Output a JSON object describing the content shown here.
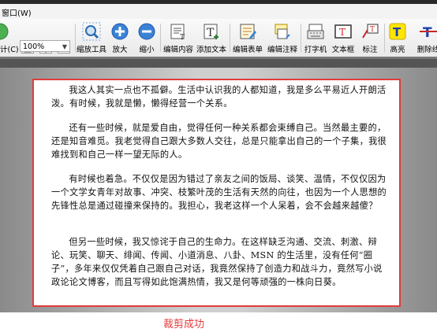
{
  "menu": {
    "window": "窗口(W)"
  },
  "toolbar": {
    "zoom_value": "100%",
    "left_partial": "计(C)",
    "items": [
      {
        "name": "zoom-tool",
        "label": "缩放工具"
      },
      {
        "name": "zoom-in",
        "label": "放大"
      },
      {
        "name": "zoom-out",
        "label": "缩小"
      },
      {
        "name": "edit-content",
        "label": "编辑内容"
      },
      {
        "name": "add-text",
        "label": "添加文本"
      },
      {
        "name": "edit-form",
        "label": "编辑表单"
      },
      {
        "name": "edit-annotation",
        "label": "编辑注释"
      },
      {
        "name": "typewriter",
        "label": "打字机"
      },
      {
        "name": "textbox",
        "label": "文本框"
      },
      {
        "name": "callout",
        "label": "标注"
      },
      {
        "name": "highlight",
        "label": "高亮"
      },
      {
        "name": "strikethrough",
        "label": "删除线"
      }
    ]
  },
  "document": {
    "paragraphs": [
      "我这人其实一点也不孤僻。生活中认识我的人都知道，我是多么平易近人开朗活泼。有时候，我就是懒，懒得经营一个关系。",
      "还有一些时候，就是爱自由，觉得任何一种关系都会束缚自己。当然最主要的，还是知音难觅。我老觉得自己跟大多数人交往，总是只能拿出自己的一个子集，我很难找到和自己一样一望无际的人。",
      "有时候也着急。不仅仅是因为错过了亲友之间的饭局、谈笑、温情，不仅仅因为一个文学女青年对故事、冲突、枝繁叶茂的生活有天然的向往，也因为一个人思想的先锋性总是通过碰撞来保持的。我担心，我老这样一个人呆着，会不会越来越傻？",
      "但另一些时候，我又惊诧于自己的生命力。在这样缺乏沟通、交流、刺激、辩论、玩笑、聊天、绯闻、传闻、小道消息、八卦、MSN 的生活里，没有任何“圈子”，多年来仅仅凭着自己跟自己对话，我竟然保持了创造力和战斗力，竟然写小说政论论文博客，而且写得如此饱满热情，我又是何等顽强的一株向日葵。"
    ]
  },
  "caption": "裁剪成功",
  "colors": {
    "crop_border": "#e23b3b",
    "caption": "#e23b3b"
  }
}
